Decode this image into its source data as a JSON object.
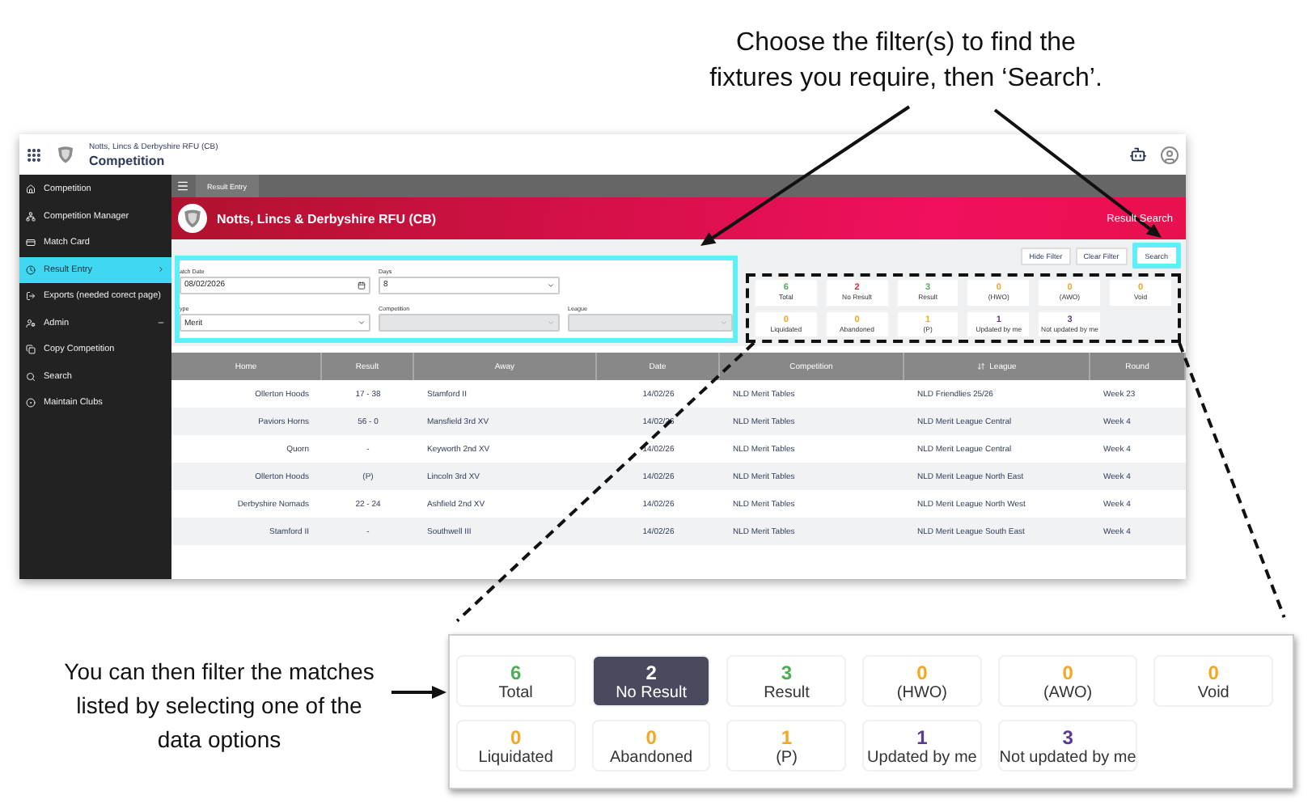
{
  "instructions": {
    "top": "Choose the filter(s) to find the fixtures you require, then ‘Search’.",
    "side": "You can then filter the matches listed by selecting one of the data options"
  },
  "app": {
    "header": {
      "org": "Notts, Lincs & Derbyshire RFU (CB)",
      "title": "Competition"
    },
    "sidebar": {
      "items": [
        {
          "label": "Competition",
          "kind": "home",
          "selected": false
        },
        {
          "label": "Competition Manager",
          "kind": "hierarchy",
          "selected": false
        },
        {
          "label": "Match Card",
          "kind": "card",
          "selected": false
        },
        {
          "label": "Result Entry",
          "kind": "clock",
          "selected": true,
          "expanded": false
        },
        {
          "label": "Exports (needed corect page)",
          "kind": "export",
          "selected": false
        },
        {
          "label": "Admin",
          "kind": "admin",
          "selected": false,
          "expanded": true
        },
        {
          "label": "Copy Competition",
          "kind": "copy",
          "selected": false
        },
        {
          "label": "Search",
          "kind": "search",
          "selected": false
        },
        {
          "label": "Maintain Clubs",
          "kind": "target",
          "selected": false
        }
      ]
    },
    "tabs": [
      {
        "label": "Result Entry",
        "selected": true
      }
    ],
    "banner": {
      "title": "Notts, Lincs & Derbyshire RFU (CB)",
      "right": "Result Search"
    },
    "buttons": [
      "Hide Filter",
      "Clear Filter",
      "Search"
    ],
    "filters": [
      {
        "label": "atch Date",
        "value": "08/02/2026",
        "kind": "date",
        "disabled": false
      },
      {
        "label": "Days",
        "value": "8",
        "kind": "select",
        "disabled": false
      },
      {
        "label": "ype",
        "value": "Merit",
        "kind": "select",
        "disabled": false
      },
      {
        "label": "Competition",
        "kind": "select",
        "disabled": true
      },
      {
        "label": "League",
        "kind": "select",
        "disabled": true
      }
    ],
    "stats": [
      {
        "value": "6",
        "label": "Total",
        "color": "#4caf50",
        "selected": false
      },
      {
        "value": "2",
        "label": "No Result",
        "color": "#d32f2f",
        "selected": false
      },
      {
        "value": "3",
        "label": "Result",
        "color": "#4caf50",
        "selected": false
      },
      {
        "value": "0",
        "label": "(HWO)",
        "color": "#f5a623",
        "selected": false
      },
      {
        "value": "0",
        "label": "(AWO)",
        "color": "#f5a623",
        "selected": false
      },
      {
        "value": "0",
        "label": "Void",
        "color": "#f5a623",
        "selected": false
      },
      {
        "value": "0",
        "label": "Liquidated",
        "color": "#f5a623",
        "selected": false
      },
      {
        "value": "0",
        "label": "Abandoned",
        "color": "#f5a623",
        "selected": false
      },
      {
        "value": "1",
        "label": "(P)",
        "color": "#f5a623",
        "selected": false
      },
      {
        "value": "1",
        "label": "Updated by me",
        "color": "#5e3a8c",
        "selected": false
      },
      {
        "value": "3",
        "label": "Not updated by me",
        "color": "#5e3a8c",
        "selected": false
      }
    ],
    "table": {
      "columns": [
        "Home",
        "Result",
        "Away",
        "Date",
        "Competition",
        "League",
        "Round"
      ],
      "rows": [
        [
          "Ollerton Hoods",
          "17 - 38",
          "Stamford II",
          "14/02/26",
          "NLD Merit Tables",
          "NLD Friendlies 25/26",
          "Week 23"
        ],
        [
          "Paviors Horns",
          "56 - 0",
          "Mansfield 3rd XV",
          "14/02/26",
          "NLD Merit Tables",
          "NLD Merit League Central",
          "Week 4"
        ],
        [
          "Quorn",
          "-",
          "Keyworth 2nd XV",
          "14/02/26",
          "NLD Merit Tables",
          "NLD Merit League Central",
          "Week 4"
        ],
        [
          "Ollerton Hoods",
          "(P)",
          "Lincoln 3rd XV",
          "14/02/26",
          "NLD Merit Tables",
          "NLD Merit League North East",
          "Week 4"
        ],
        [
          "Derbyshire Nomads",
          "22 - 24",
          "Ashfield 2nd XV",
          "14/02/26",
          "NLD Merit Tables",
          "NLD Merit League North West",
          "Week 4"
        ],
        [
          "Stamford II",
          "-",
          "Southwell III",
          "14/02/26",
          "NLD Merit Tables",
          "NLD Merit League South East",
          "Week 4"
        ]
      ]
    }
  },
  "zoom_panel": {
    "stats": [
      {
        "value": "6",
        "label": "Total",
        "color": "#4caf50",
        "selected": false
      },
      {
        "value": "2",
        "label": "No Result",
        "selected": true
      },
      {
        "value": "3",
        "label": "Result",
        "color": "#4caf50",
        "selected": false
      },
      {
        "value": "0",
        "label": "(HWO)",
        "color": "#f5a623",
        "selected": false
      },
      {
        "value": "0",
        "label": "(AWO)",
        "color": "#f5a623",
        "selected": false
      },
      {
        "value": "0",
        "label": "Void",
        "color": "#f5a623",
        "selected": false
      },
      {
        "value": "0",
        "label": "Liquidated",
        "color": "#f5a623",
        "selected": false
      },
      {
        "value": "0",
        "label": "Abandoned",
        "color": "#f5a623",
        "selected": false
      },
      {
        "value": "1",
        "label": "(P)",
        "color": "#f5a623",
        "selected": false
      },
      {
        "value": "1",
        "label": "Updated by me",
        "color": "#5e3a8c",
        "selected": false
      },
      {
        "value": "3",
        "label": "Not updated by me",
        "color": "#5e3a8c",
        "selected": false
      }
    ]
  }
}
